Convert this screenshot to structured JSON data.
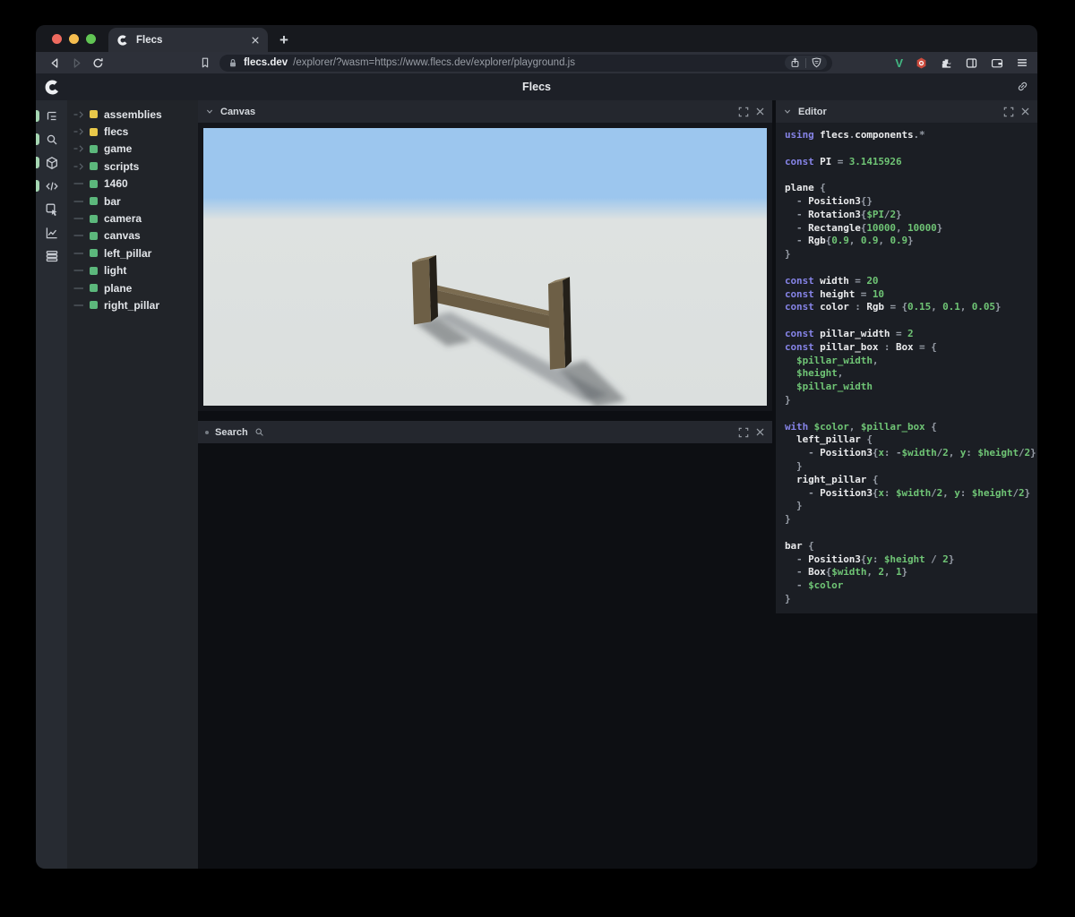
{
  "colors": {
    "sky": "#9cc6ee",
    "ground": "#dee2e1",
    "wood": "#6d5f46",
    "wood_dark": "#242019",
    "wood_top": "#8d7e61",
    "tree_green": "#5cb87c",
    "tree_yellow": "#e8c84a",
    "code_keyword": "#8583e6",
    "code_ident": "#e9eaec",
    "code_value": "#6fc475",
    "code_punct": "#969ca6",
    "active_pill": "#a5d6b2",
    "traffic_red": "#ee6a5f",
    "traffic_yellow": "#f5bd4f",
    "traffic_green": "#61c554",
    "vue_green": "#42b883",
    "ext_red": "#cc4b3d"
  },
  "browser": {
    "tab": {
      "title": "Flecs"
    },
    "url": {
      "host": "flecs.dev",
      "path": "/explorer/?wasm=https://www.flecs.dev/explorer/playground.js"
    },
    "newtab_label": "+"
  },
  "header": {
    "title": "Flecs"
  },
  "sidebar": {
    "icons": [
      {
        "name": "outliner",
        "active": true
      },
      {
        "name": "search",
        "active": true
      },
      {
        "name": "entities",
        "active": true
      },
      {
        "name": "code",
        "active": true
      },
      {
        "name": "inspector",
        "active": false
      },
      {
        "name": "stats",
        "active": false
      },
      {
        "name": "data",
        "active": false
      }
    ]
  },
  "tree": {
    "items": [
      {
        "label": "assemblies",
        "dot": "yellow",
        "expandable": true
      },
      {
        "label": "flecs",
        "dot": "yellow",
        "expandable": true
      },
      {
        "label": "game",
        "dot": "green",
        "expandable": true
      },
      {
        "label": "scripts",
        "dot": "green",
        "expandable": true
      },
      {
        "label": "1460",
        "dot": "green",
        "expandable": false
      },
      {
        "label": "bar",
        "dot": "green",
        "expandable": false
      },
      {
        "label": "camera",
        "dot": "green",
        "expandable": false
      },
      {
        "label": "canvas",
        "dot": "green",
        "expandable": false
      },
      {
        "label": "left_pillar",
        "dot": "green",
        "expandable": false
      },
      {
        "label": "light",
        "dot": "green",
        "expandable": false
      },
      {
        "label": "plane",
        "dot": "green",
        "expandable": false
      },
      {
        "label": "right_pillar",
        "dot": "green",
        "expandable": false
      }
    ]
  },
  "panels": {
    "canvas": {
      "title": "Canvas"
    },
    "search": {
      "title": "Search"
    },
    "editor": {
      "title": "Editor"
    }
  },
  "editor": {
    "lines": [
      [
        [
          "k",
          "using "
        ],
        [
          "i",
          "flecs"
        ],
        [
          "p",
          "."
        ],
        [
          "i",
          "components"
        ],
        [
          "p",
          ".*"
        ]
      ],
      [],
      [
        [
          "k",
          "const "
        ],
        [
          "i",
          "PI"
        ],
        [
          "p",
          " = "
        ],
        [
          "n",
          "3.1415926"
        ]
      ],
      [],
      [
        [
          "i",
          "plane "
        ],
        [
          "p",
          "{"
        ]
      ],
      [
        [
          "p",
          "  - "
        ],
        [
          "i",
          "Position3"
        ],
        [
          "p",
          "{}"
        ]
      ],
      [
        [
          "p",
          "  - "
        ],
        [
          "i",
          "Rotation3"
        ],
        [
          "p",
          "{"
        ],
        [
          "n",
          "$PI"
        ],
        [
          "p",
          "/"
        ],
        [
          "n",
          "2"
        ],
        [
          "p",
          "}"
        ]
      ],
      [
        [
          "p",
          "  - "
        ],
        [
          "i",
          "Rectangle"
        ],
        [
          "p",
          "{"
        ],
        [
          "n",
          "10000"
        ],
        [
          "p",
          ", "
        ],
        [
          "n",
          "10000"
        ],
        [
          "p",
          "}"
        ]
      ],
      [
        [
          "p",
          "  - "
        ],
        [
          "i",
          "Rgb"
        ],
        [
          "p",
          "{"
        ],
        [
          "n",
          "0.9"
        ],
        [
          "p",
          ", "
        ],
        [
          "n",
          "0.9"
        ],
        [
          "p",
          ", "
        ],
        [
          "n",
          "0.9"
        ],
        [
          "p",
          "}"
        ]
      ],
      [
        [
          "p",
          "}"
        ]
      ],
      [],
      [
        [
          "k",
          "const "
        ],
        [
          "i",
          "width"
        ],
        [
          "p",
          " = "
        ],
        [
          "n",
          "20"
        ]
      ],
      [
        [
          "k",
          "const "
        ],
        [
          "i",
          "height"
        ],
        [
          "p",
          " = "
        ],
        [
          "n",
          "10"
        ]
      ],
      [
        [
          "k",
          "const "
        ],
        [
          "i",
          "color"
        ],
        [
          "p",
          " : "
        ],
        [
          "i",
          "Rgb"
        ],
        [
          "p",
          " = {"
        ],
        [
          "n",
          "0.15"
        ],
        [
          "p",
          ", "
        ],
        [
          "n",
          "0.1"
        ],
        [
          "p",
          ", "
        ],
        [
          "n",
          "0.05"
        ],
        [
          "p",
          "}"
        ]
      ],
      [],
      [
        [
          "k",
          "const "
        ],
        [
          "i",
          "pillar_width"
        ],
        [
          "p",
          " = "
        ],
        [
          "n",
          "2"
        ]
      ],
      [
        [
          "k",
          "const "
        ],
        [
          "i",
          "pillar_box"
        ],
        [
          "p",
          " : "
        ],
        [
          "i",
          "Box"
        ],
        [
          "p",
          " = {"
        ]
      ],
      [
        [
          "n",
          "  $pillar_width"
        ],
        [
          "p",
          ","
        ]
      ],
      [
        [
          "n",
          "  $height"
        ],
        [
          "p",
          ","
        ]
      ],
      [
        [
          "n",
          "  $pillar_width"
        ]
      ],
      [
        [
          "p",
          "}"
        ]
      ],
      [],
      [
        [
          "k",
          "with "
        ],
        [
          "n",
          "$color"
        ],
        [
          "p",
          ", "
        ],
        [
          "n",
          "$pillar_box"
        ],
        [
          "p",
          " {"
        ]
      ],
      [
        [
          "i",
          "  left_pillar "
        ],
        [
          "p",
          "{"
        ]
      ],
      [
        [
          "p",
          "    - "
        ],
        [
          "i",
          "Position3"
        ],
        [
          "p",
          "{"
        ],
        [
          "n",
          "x"
        ],
        [
          "p",
          ": -"
        ],
        [
          "n",
          "$width"
        ],
        [
          "p",
          "/"
        ],
        [
          "n",
          "2"
        ],
        [
          "p",
          ", "
        ],
        [
          "n",
          "y"
        ],
        [
          "p",
          ": "
        ],
        [
          "n",
          "$height"
        ],
        [
          "p",
          "/"
        ],
        [
          "n",
          "2"
        ],
        [
          "p",
          "}"
        ]
      ],
      [
        [
          "p",
          "  }"
        ]
      ],
      [
        [
          "i",
          "  right_pillar "
        ],
        [
          "p",
          "{"
        ]
      ],
      [
        [
          "p",
          "    - "
        ],
        [
          "i",
          "Position3"
        ],
        [
          "p",
          "{"
        ],
        [
          "n",
          "x"
        ],
        [
          "p",
          ": "
        ],
        [
          "n",
          "$width"
        ],
        [
          "p",
          "/"
        ],
        [
          "n",
          "2"
        ],
        [
          "p",
          ", "
        ],
        [
          "n",
          "y"
        ],
        [
          "p",
          ": "
        ],
        [
          "n",
          "$height"
        ],
        [
          "p",
          "/"
        ],
        [
          "n",
          "2"
        ],
        [
          "p",
          "}"
        ]
      ],
      [
        [
          "p",
          "  }"
        ]
      ],
      [
        [
          "p",
          "}"
        ]
      ],
      [],
      [
        [
          "i",
          "bar "
        ],
        [
          "p",
          "{"
        ]
      ],
      [
        [
          "p",
          "  - "
        ],
        [
          "i",
          "Position3"
        ],
        [
          "p",
          "{"
        ],
        [
          "n",
          "y"
        ],
        [
          "p",
          ": "
        ],
        [
          "n",
          "$height"
        ],
        [
          "p",
          " / "
        ],
        [
          "n",
          "2"
        ],
        [
          "p",
          "}"
        ]
      ],
      [
        [
          "p",
          "  - "
        ],
        [
          "i",
          "Box"
        ],
        [
          "p",
          "{"
        ],
        [
          "n",
          "$width"
        ],
        [
          "p",
          ", "
        ],
        [
          "n",
          "2"
        ],
        [
          "p",
          ", "
        ],
        [
          "n",
          "1"
        ],
        [
          "p",
          "}"
        ]
      ],
      [
        [
          "p",
          "  - "
        ],
        [
          "n",
          "$color"
        ]
      ],
      [
        [
          "p",
          "}"
        ]
      ]
    ]
  }
}
